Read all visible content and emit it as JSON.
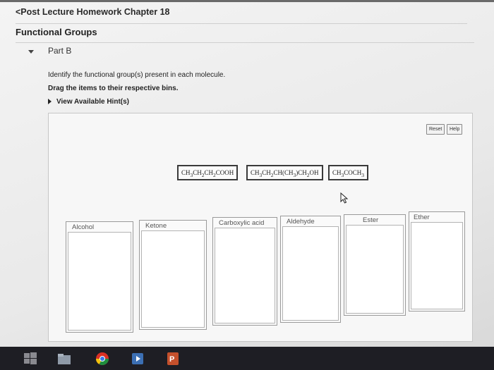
{
  "header": {
    "back_label": "<Post Lecture Homework Chapter 18",
    "title": "Functional Groups"
  },
  "part": {
    "title": "Part B",
    "instruction": "Identify the functional group(s) present in each molecule.",
    "drag_instruction": "Drag the items to their respective bins.",
    "hint_label": "View Available Hint(s)"
  },
  "toolbar": {
    "reset_label": "Reset",
    "help_label": "Help"
  },
  "tiles": [
    {
      "label": "CH3CH2CH2COOH"
    },
    {
      "label": "CH3CH2CH(CH3)CH2OH"
    },
    {
      "label": "CH3COCH3"
    }
  ],
  "bins": [
    {
      "label": "Alcohol"
    },
    {
      "label": "Ketone"
    },
    {
      "label": "Carboxylic acid"
    },
    {
      "label": "Aldehyde"
    },
    {
      "label": "Ester"
    },
    {
      "label": "Ether"
    }
  ],
  "taskbar": {
    "icons": [
      "windows-icon",
      "file-explorer-icon",
      "chrome-icon",
      "media-player-icon",
      "powerpoint-icon"
    ]
  },
  "colors": {
    "taskbar": "#1e1e24",
    "chrome_red": "#d93025",
    "chrome_yellow": "#f4c20d",
    "chrome_green": "#1e8e3e",
    "powerpoint": "#c5502c"
  }
}
